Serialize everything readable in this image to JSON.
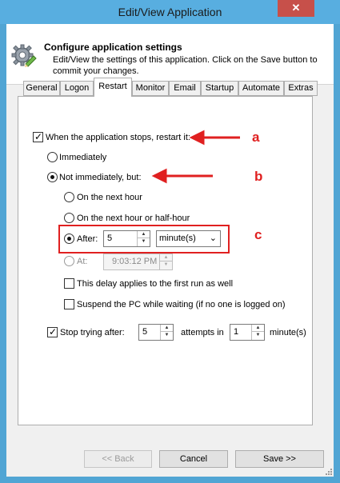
{
  "window": {
    "title": "Edit/View Application",
    "close_glyph": "✕"
  },
  "header": {
    "title": "Configure application settings",
    "subtitle": "Edit/View the settings of this application. Click on the Save button to commit your changes.",
    "icon": "gear-icon"
  },
  "tabs": [
    {
      "label": "General",
      "active": false
    },
    {
      "label": "Logon",
      "active": false
    },
    {
      "label": "Restart",
      "active": true
    },
    {
      "label": "Monitor",
      "active": false
    },
    {
      "label": "Email",
      "active": false
    },
    {
      "label": "Startup",
      "active": false
    },
    {
      "label": "Automate",
      "active": false
    },
    {
      "label": "Extras",
      "active": false
    }
  ],
  "restart": {
    "restart_label": "When the application stops, restart it:",
    "restart_checked": true,
    "immediately_label": "Immediately",
    "not_immediately_label": "Not immediately, but:",
    "next_hour_label": "On the next hour",
    "next_half_hour_label": "On the next hour or half-hour",
    "after_label": "After:",
    "after_value": "5",
    "after_unit": "minute(s)",
    "at_label": "At:",
    "at_value": "9:03:12 PM",
    "first_run_label": "This delay applies to the first run as well",
    "suspend_label": "Suspend the PC while waiting (if no one is logged on)",
    "stop_label": "Stop trying after:",
    "stop_checked": true,
    "stop_attempts": "5",
    "attempts_in_label": "attempts in",
    "stop_minutes": "1",
    "minutes_label": "minute(s)"
  },
  "annotations": {
    "a": "a",
    "b": "b",
    "c": "c",
    "color": "#e02020"
  },
  "buttons": {
    "back": "<< Back",
    "cancel": "Cancel",
    "save": "Save >>"
  },
  "colors": {
    "titlebar": "#58aee0",
    "close": "#c7504a",
    "accent": "#e02020"
  }
}
